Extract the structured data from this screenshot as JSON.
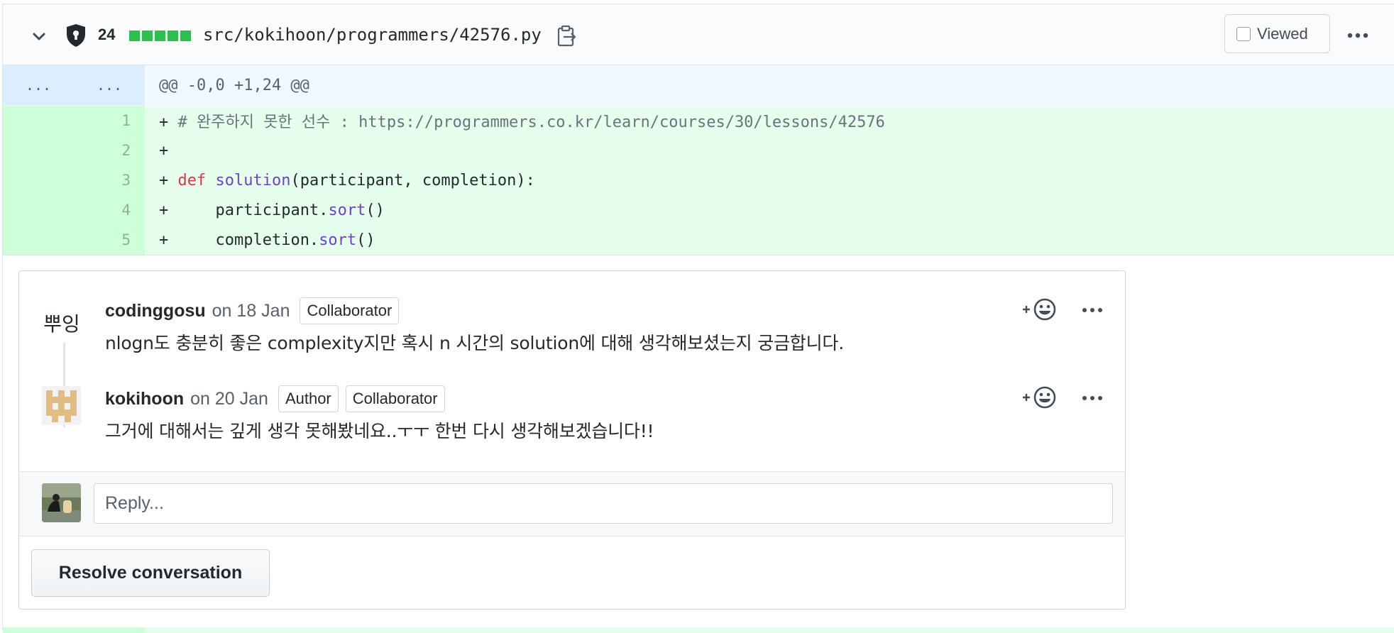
{
  "file": {
    "changes_count": "24",
    "path": "src/kokihoon/programmers/42576.py",
    "viewed_label": "Viewed",
    "icons": [
      "chevron-down-icon",
      "shield-lock-icon",
      "copy-icon",
      "kebab-icon"
    ]
  },
  "hunk": {
    "left_marker": "...",
    "right_marker": "...",
    "header": "@@ -0,0 +1,24 @@"
  },
  "lines": [
    {
      "num": "1",
      "prefix": "+ ",
      "comment": "# 완주하지 못한 선수 : https://programmers.co.kr/learn/courses/30/lessons/42576"
    },
    {
      "num": "2",
      "prefix": "+"
    },
    {
      "num": "3",
      "prefix": "+ ",
      "kw": "def",
      "fn": "solution",
      "rest": "(participant, completion):"
    },
    {
      "num": "4",
      "prefix": "+     ",
      "obj": "participant.",
      "fn": "sort",
      "rest": "()"
    },
    {
      "num": "5",
      "prefix": "+     ",
      "obj": "completion.",
      "fn": "sort",
      "rest": "()"
    }
  ],
  "thread": {
    "comments": [
      {
        "avatar_text": "뿌잉",
        "user": "codinggosu",
        "date": "on 18 Jan",
        "badges": [
          "Collaborator"
        ],
        "body": "nlogn도 충분히 좋은 complexity지만 혹시 n 시간의 solution에 대해 생각해보셨는지 궁금합니다."
      },
      {
        "user": "kokihoon",
        "date": "on 20 Jan",
        "badges": [
          "Author",
          "Collaborator"
        ],
        "body": "그거에 대해서는 깊게 생각 못해봤네요..ㅜㅜ 한번 다시 생각해보겠습니다!!"
      }
    ],
    "reply_placeholder": "Reply...",
    "resolve_label": "Resolve conversation",
    "react_label": "+"
  }
}
